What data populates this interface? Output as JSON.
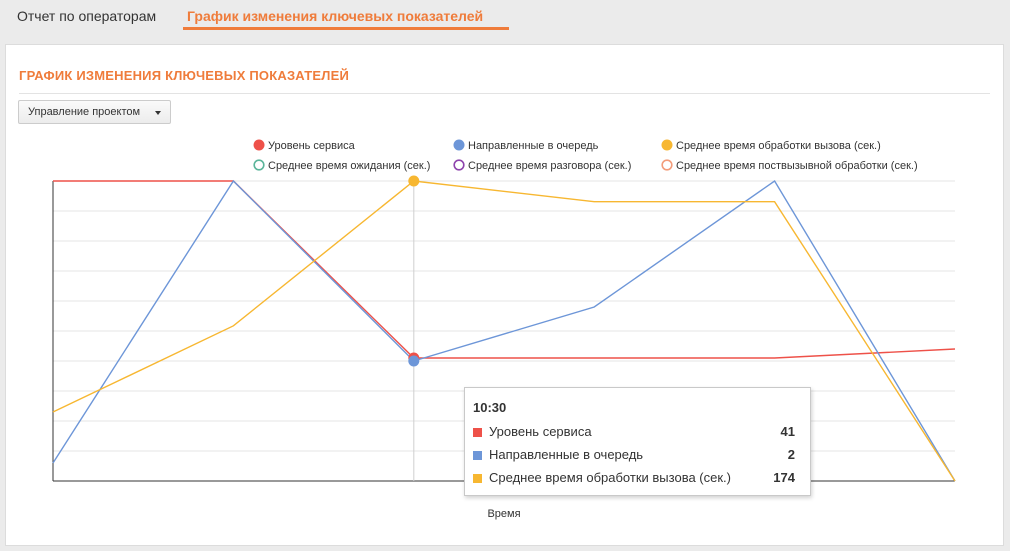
{
  "tabs": [
    {
      "label": "Отчет по операторам",
      "active": false
    },
    {
      "label": "График изменения ключевых показателей",
      "active": true
    }
  ],
  "section": {
    "title": "ГРАФИК ИЗМЕНЕНИЯ КЛЮЧЕВЫХ ПОКАЗАТЕЛЕЙ"
  },
  "dropdown": {
    "label": "Управление проектом"
  },
  "colors": {
    "accent": "#ef7c3b"
  },
  "chart_data": {
    "type": "line",
    "xlabel": "Время",
    "ylabel": "",
    "legend_placement": "top",
    "grid": true,
    "highlighted_point_index": 2,
    "series": [
      {
        "name": "Уровень сервиса",
        "color": "#ee5149",
        "marker": "filled",
        "values": [
          100,
          100,
          41,
          41,
          41,
          44
        ]
      },
      {
        "name": "Направленные в очередь",
        "color": "#6d96d8",
        "marker": "filled",
        "values": [
          0.3,
          5,
          2,
          2.9,
          5,
          0
        ]
      },
      {
        "name": "Среднее время обработки вызова (сек.)",
        "color": "#f7b731",
        "marker": "filled",
        "values": [
          40,
          90,
          174,
          162,
          162,
          0
        ]
      },
      {
        "name": "Среднее время ожидания (сек.)",
        "color": "#5bb59a",
        "marker": "hollow",
        "values": []
      },
      {
        "name": "Среднее время разговора (сек.)",
        "color": "#8e44ad",
        "marker": "hollow",
        "values": []
      },
      {
        "name": "Среднее время поствызывной обработки (сек.)",
        "color": "#f39c7a",
        "marker": "hollow",
        "values": []
      }
    ]
  },
  "tooltip": {
    "time": "10:30",
    "rows": [
      {
        "label": "Уровень сервиса",
        "value": "41",
        "color": "#ee5149"
      },
      {
        "label": "Направленные в очередь",
        "value": "2",
        "color": "#6d96d8"
      },
      {
        "label": "Среднее время обработки вызова (сек.)",
        "value": "174",
        "color": "#f7b731"
      }
    ]
  }
}
